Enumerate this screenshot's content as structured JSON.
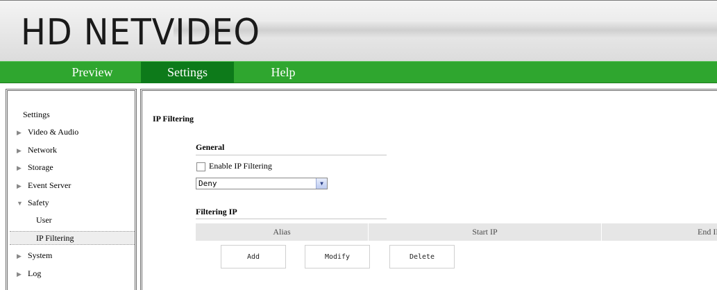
{
  "header": {
    "logo_text": "HD NETVIDEO"
  },
  "nav": {
    "tabs": [
      {
        "label": "Preview",
        "active": false
      },
      {
        "label": "Settings",
        "active": true
      },
      {
        "label": "Help",
        "active": false
      }
    ]
  },
  "sidebar": {
    "title": "Settings",
    "items": [
      {
        "label": "Video & Audio",
        "expanded": false
      },
      {
        "label": "Network",
        "expanded": false
      },
      {
        "label": "Storage",
        "expanded": false
      },
      {
        "label": "Event Server",
        "expanded": false
      },
      {
        "label": "Safety",
        "expanded": true
      },
      {
        "label": "System",
        "expanded": false
      },
      {
        "label": "Log",
        "expanded": false
      }
    ],
    "subitems": [
      {
        "label": "User",
        "selected": false
      },
      {
        "label": "IP Filtering",
        "selected": true
      }
    ]
  },
  "main": {
    "page_title": "IP Filtering",
    "general": {
      "title": "General",
      "enable_label": "Enable IP Filtering",
      "enable_checked": false,
      "mode_value": "Deny"
    },
    "filtering": {
      "title": "Filtering IP",
      "columns": [
        "Alias",
        "Start IP",
        "End IP"
      ]
    },
    "buttons": {
      "add": "Add",
      "modify": "Modify",
      "delete": "Delete"
    }
  },
  "colors": {
    "nav_green": "#2fa62f",
    "nav_active": "#0d7a1a",
    "table_header": "#e6e6e6"
  }
}
